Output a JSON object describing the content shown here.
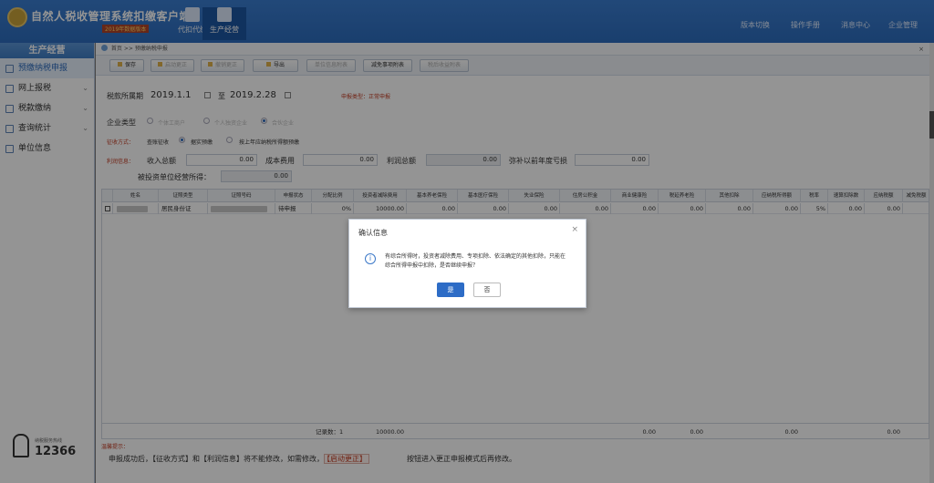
{
  "header": {
    "title": "自然人税收管理系统扣缴客户端",
    "subtitle": "2019年数据版本",
    "tabs": [
      {
        "label": "代扣代缴"
      },
      {
        "label": "生产经营"
      }
    ],
    "links": [
      {
        "label": "版本切换"
      },
      {
        "label": "操作手册"
      },
      {
        "label": "消息中心"
      },
      {
        "label": "企业管理"
      }
    ]
  },
  "sidebar": {
    "title": "生产经营",
    "items": [
      {
        "label": "预缴纳税申报"
      },
      {
        "label": "网上报税"
      },
      {
        "label": "税款缴纳"
      },
      {
        "label": "查询统计"
      },
      {
        "label": "单位信息"
      }
    ],
    "hotline_label": "纳税服务热线",
    "hotline": "12366"
  },
  "breadcrumb": {
    "home": "首页",
    "sep": ">>",
    "current": "预缴纳税申报"
  },
  "toolbar": {
    "buttons": [
      "保存",
      "启动更正",
      "撤销更正",
      "导出",
      "单位信息附表",
      "减免事项附表",
      "税后收益附表"
    ]
  },
  "form": {
    "period_label": "税款所属期",
    "period_from": "2019.1.1",
    "period_to_label": "至",
    "period_to": "2019.2.28",
    "status": "申报类型：正常申报",
    "company_type_label": "企业类型",
    "company_types": [
      "个体工商户",
      "个人独资企业",
      "合伙企业"
    ],
    "levy_label": "征收方式：",
    "levy_options": [
      "查账征收",
      "据实预缴",
      "按上年应纳税所得额预缴"
    ],
    "profit_label": "利润信息：",
    "income_label": "收入总额",
    "income": "0.00",
    "cost_label": "成本费用",
    "cost": "0.00",
    "profit_total_label": "利润总额",
    "profit_total": "0.00",
    "loss_label": "弥补以前年度亏损",
    "loss": "0.00",
    "invested_label": "被投资单位经营所得：",
    "invested": "0.00"
  },
  "table": {
    "headers": [
      "",
      "姓名",
      "证照类型",
      "证照号码",
      "申报状态",
      "分配比例",
      "投资者减除费用",
      "基本养老保险",
      "基本医疗保险",
      "失业保险",
      "住房公积金",
      "商业健康险",
      "税延养老险",
      "其他扣除",
      "应纳税所得额",
      "税率",
      "速算扣除数",
      "应纳税额",
      "减免税额"
    ],
    "rows": [
      {
        "id_type": "居民身份证",
        "status": "待申报",
        "ratio": "0%",
        "deduct": "10000.00",
        "pension": "0.00",
        "medical": "0.00",
        "unemp": "0.00",
        "housing": "0.00",
        "health": "0.00",
        "delay": "0.00",
        "other": "0.00",
        "taxable": "0.00",
        "rate": "5%",
        "quick": "0.00",
        "tax": "0.00"
      }
    ],
    "footer": {
      "count_label": "记录数：1",
      "deduct": "10000.00",
      "health": "0.00",
      "delay": "0.00",
      "taxable": "0.00",
      "tax": "0.00"
    }
  },
  "notes": {
    "title": "温馨提示：",
    "line_a": "申报成功后，【征收方式】和【利润信息】将不能修改，如需修改，",
    "tag": "【启动更正】",
    "line_b": "按钮进入更正申报模式后再修改。"
  },
  "dialog": {
    "title": "确认信息",
    "message": "有综合所得时，投资者减除费用、专项扣除、依法确定的其他扣除，只能在综合所得申报中扣除，是否继续申报？",
    "yes": "是",
    "no": "否"
  }
}
